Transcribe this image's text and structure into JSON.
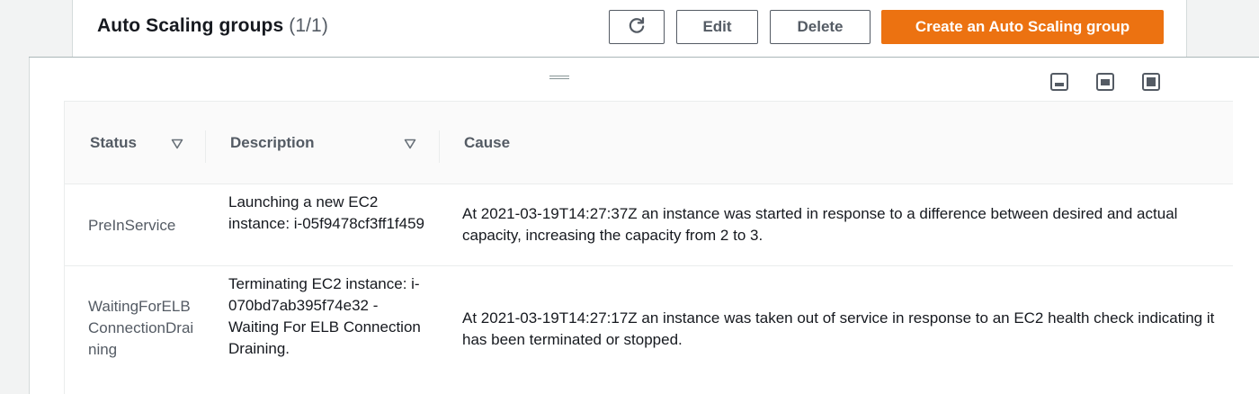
{
  "header": {
    "title": "Auto Scaling groups",
    "count": "(1/1)",
    "buttons": {
      "refresh_icon": "refresh-icon",
      "edit": "Edit",
      "delete": "Delete",
      "create": "Create an Auto Scaling group"
    }
  },
  "colors": {
    "primary": "#ec7211",
    "text": "#16191f",
    "secondary_text": "#545b64"
  },
  "split_panel": {
    "preference_icons": [
      "panel-bottom-icon",
      "panel-center-icon",
      "panel-full-icon"
    ]
  },
  "table": {
    "columns": [
      "Status",
      "Description",
      "Cause"
    ],
    "rows": [
      {
        "status": "PreInService",
        "description": "Launching a new EC2 instance: i-05f9478cf3ff1f459",
        "cause": "At 2021-03-19T14:27:37Z an instance was started in response to a difference between desired and actual capacity, increasing the capacity from 2 to 3."
      },
      {
        "status": "WaitingForELBConnectionDraining",
        "description": "Terminating EC2 instance: i-070bd7ab395f74e32 - Waiting For ELB Connection Draining.",
        "cause": "At 2021-03-19T14:27:17Z an instance was taken out of service in response to an EC2 health check indicating it has been terminated or stopped."
      }
    ]
  }
}
